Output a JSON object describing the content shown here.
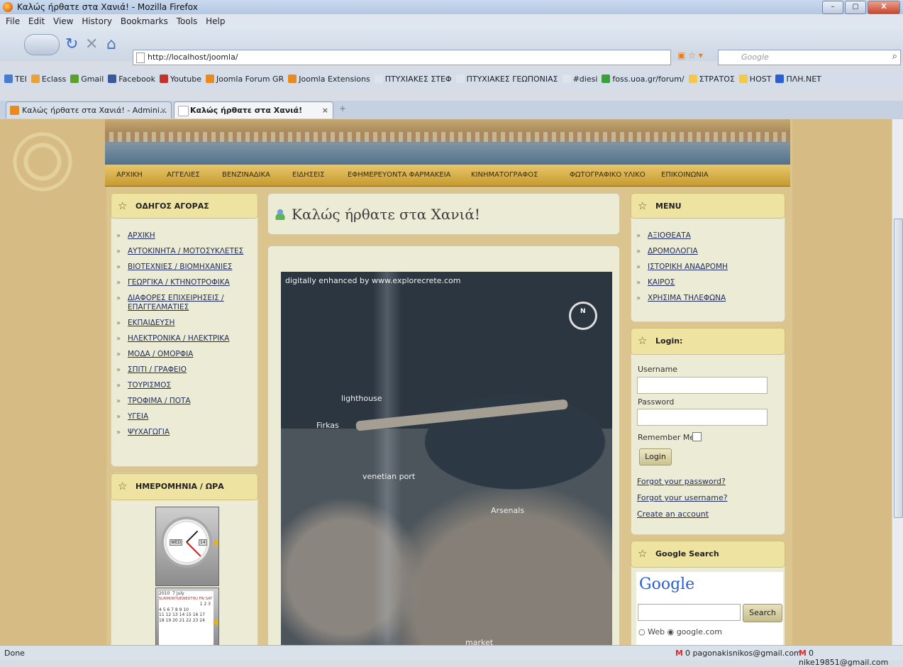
{
  "window": {
    "title": "Καλώς ήρθατε στα Χανιά! - Mozilla Firefox",
    "buttons": [
      "–",
      "▢",
      "X"
    ]
  },
  "menu": [
    "File",
    "Edit",
    "View",
    "History",
    "Bookmarks",
    "Tools",
    "Help"
  ],
  "nav": {
    "url": "http://localhost/joomla/",
    "search_placeholder": "Google"
  },
  "bookmarks": [
    {
      "label": "TEI",
      "color": "#4a7bd0"
    },
    {
      "label": "Eclass",
      "color": "#e7a23a"
    },
    {
      "label": "Gmail",
      "color": "#5aa02c"
    },
    {
      "label": "Facebook",
      "color": "#3b5998"
    },
    {
      "label": "Youtube",
      "color": "#c4302b"
    },
    {
      "label": "Joomla Forum GR",
      "color": "#e98a1f"
    },
    {
      "label": "Joomla Extensions",
      "color": "#e98a1f"
    },
    {
      "label": "ΠΤΥΧΙΑΚΕΣ ΣΤΕΦ",
      "color": "#dfe4ea"
    },
    {
      "label": "ΠΤΥΧΙΑΚΕΣ ΓΕΩΠΟΝΙΑΣ",
      "color": "#dfe4ea"
    },
    {
      "label": "#diesi",
      "color": "#dfe4ea"
    },
    {
      "label": "foss.uoa.gr/forum/",
      "color": "#3aa03a"
    },
    {
      "label": "ΣΤΡΑΤΟΣ",
      "color": "#f2c94c"
    },
    {
      "label": "HOST",
      "color": "#f2c94c"
    },
    {
      "label": "ΠΛΗ.ΝΕΤ",
      "color": "#2a5fd1"
    }
  ],
  "tabs": [
    {
      "label": "Καλώς ήρθατε στα Χανιά! - Admini...",
      "active": false
    },
    {
      "label": "Καλώς ήρθατε στα Χανιά!",
      "active": true
    }
  ],
  "topnav": [
    "ΑΡΧΙΚΗ",
    "ΑΓΓΕΛΙΕΣ",
    "ΒΕΝΖΙΝΑΔΙΚΑ",
    "ΕΙΔΗΣΕΙΣ",
    "ΕΦΗΜΕΡΕΥΟΝΤΑ ΦΑΡΜΑΚΕΙΑ",
    "ΚΙΝΗΜΑΤΟΓΡΑΦΟΣ",
    "ΦΩΤΟΓΡΑΦΙΚΟ ΥΛΙΚΟ",
    "ΕΠΙΚΟΙΝΩΝΙΑ"
  ],
  "left": {
    "guide_title": "ΟΔΗΓΟΣ ΑΓΟΡΑΣ",
    "guide_items": [
      "ΑΡΧΙΚΗ",
      "ΑΥΤΟΚΙΝΗΤΑ / ΜΟΤΟΣΥΚΛΕΤΕΣ",
      "ΒΙΟΤΕΧΝΙΕΣ / ΒΙΟΜΗΧΑΝΙΕΣ",
      "ΓΕΩΡΓΙΚΑ / ΚΤΗΝΟΤΡΟΦΙΚΑ",
      "ΔΙΑΦΟΡΕΣ ΕΠΙΧΕΙΡΗΣΕΙΣ / ΕΠΑΓΓΕΛΜΑΤΙΕΣ",
      "ΕΚΠΑΙΔΕΥΣΗ",
      "ΗΛΕΚΤΡΟΝΙΚΑ / ΗΛΕΚΤΡΙΚΑ",
      "ΜΟΔΑ / ΟΜΟΡΦΙΑ",
      "ΣΠΙΤΙ / ΓΡΑΦΕΙΟ",
      "ΤΟΥΡΙΣΜΟΣ",
      "ΤΡΟΦΙΜΑ / ΠΟΤΑ",
      "ΥΓΕΙΑ",
      "ΨΥΧΑΓΩΓΙΑ"
    ],
    "date_title": "ΗΜΕΡΟΜΗΝΙΑ / ΩΡΑ",
    "clock": {
      "weekday": "WED",
      "day": "14"
    },
    "calendar": {
      "year": "2010",
      "month": "7 July",
      "days_header": "SUNMONTUEWEDTHU FRI SAT",
      "rows": [
        "1 2 3",
        "4 5 6 7 8 9 10",
        "11 12 13 14 15 16 17",
        "18 19 20 21 22 23 24"
      ]
    }
  },
  "center": {
    "welcome": "Καλώς ήρθατε στα Χανιά!",
    "map_credit": "digitally enhanced by www.explorecrete.com",
    "map_labels": [
      "lighthouse",
      "Firkas",
      "venetian port",
      "Arsenals",
      "market"
    ]
  },
  "right": {
    "menu_title": "MENU",
    "menu_items": [
      "ΑΞΙΟΘΕΑΤΑ",
      "ΔΡΟΜΟΛΟΓΙΑ",
      "ΙΣΤΟΡΙΚΗ ΑΝΑΔΡΟΜΗ",
      "ΚΑΙΡΟΣ",
      "ΧΡΗΣΙΜΑ ΤΗΛΕΦΩΝΑ"
    ],
    "login_title": "Login:",
    "username_label": "Username",
    "password_label": "Password",
    "remember_label": "Remember Me",
    "login_button": "Login",
    "forgot_password": "Forgot your password?",
    "forgot_username": "Forgot your username?",
    "create_account": "Create an account",
    "gsearch_title": "Google Search",
    "google_logo": "Google",
    "search_button": "Search",
    "radio_web": "Web",
    "radio_site": "google.com"
  },
  "status": {
    "text": "Done",
    "mail1": "0 pagonakisnikos@gmail.com",
    "mail2": "0 nike19851@gmail.com"
  }
}
